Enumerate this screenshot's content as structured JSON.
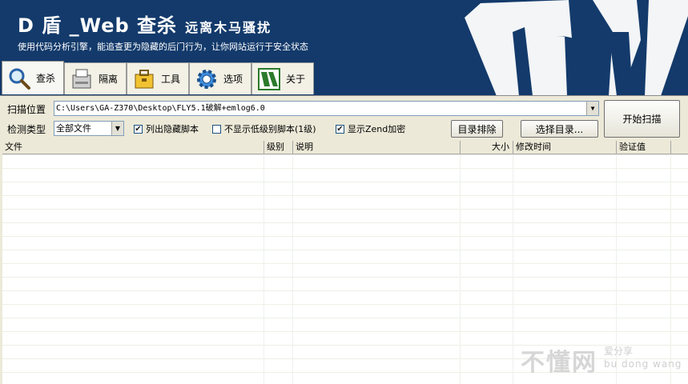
{
  "banner": {
    "title": "D 盾 _Web 查杀",
    "title_sub": "远离木马骚扰",
    "subtitle": "使用代码分析引擎，能追查更为隐藏的后门行为，让你网站运行于安全状态",
    "logo_text": "DI",
    "brand_color": "#133a6b"
  },
  "tabs": [
    {
      "label": "查杀",
      "icon": "magnifier-icon"
    },
    {
      "label": "隔离",
      "icon": "printer-box-icon"
    },
    {
      "label": "工具",
      "icon": "toolbox-icon"
    },
    {
      "label": "选项",
      "icon": "gear-icon"
    },
    {
      "label": "关于",
      "icon": "d-logo-icon"
    }
  ],
  "scan": {
    "location_label": "扫描位置",
    "path": "C:\\Users\\GA-Z370\\Desktop\\FLY5.1破解+emlog6.0",
    "type_label": "检测类型",
    "type_value": "全部文件",
    "chk_hidden": "列出隐藏脚本",
    "chk_hidden_checked": true,
    "chk_lowlevel": "不显示低级别脚本(1级)",
    "chk_lowlevel_checked": false,
    "chk_zend": "显示Zend加密",
    "chk_zend_checked": true,
    "exclude_button": "目录排除",
    "select_dir_button": "选择目录...",
    "start_button": "开始扫描"
  },
  "table": {
    "columns": [
      "文件",
      "级别",
      "说明",
      "大小",
      "修改时间",
      "验证值"
    ],
    "rows": []
  },
  "watermark": {
    "big": "不懂网",
    "small": "爱分享",
    "pinyin": "bu dong wang"
  }
}
